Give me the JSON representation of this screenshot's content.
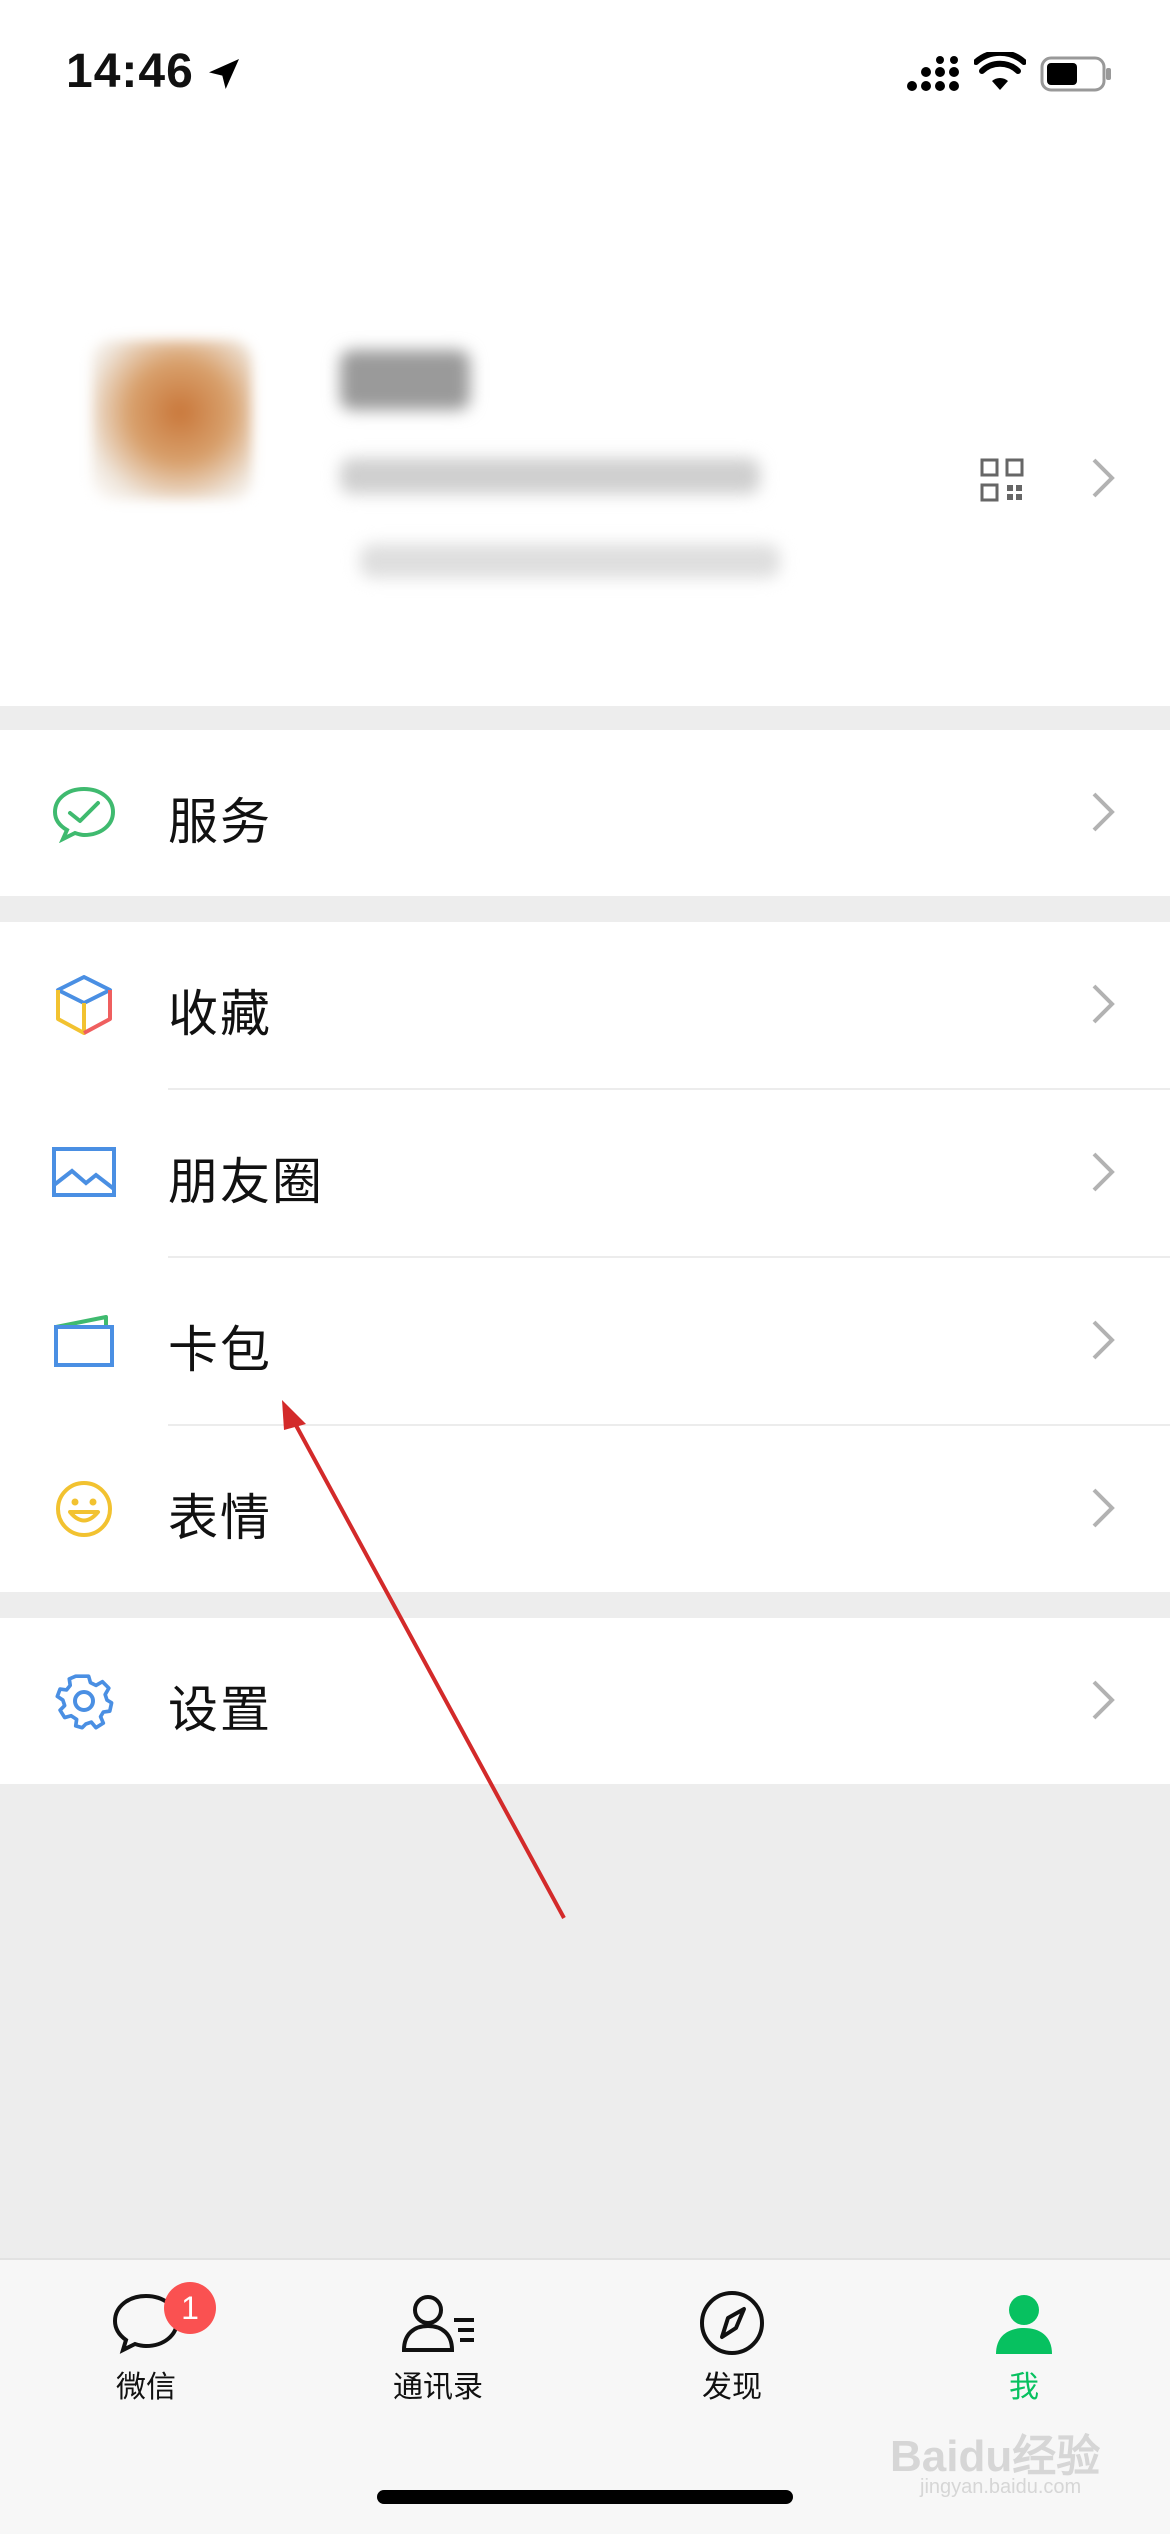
{
  "status_bar": {
    "time": "14:46"
  },
  "menu": {
    "services": {
      "label": "服务"
    },
    "favorites": {
      "label": "收藏"
    },
    "moments": {
      "label": "朋友圈"
    },
    "card_wallet": {
      "label": "卡包"
    },
    "stickers": {
      "label": "表情"
    },
    "settings": {
      "label": "设置"
    }
  },
  "tabbar": {
    "chats": {
      "label": "微信",
      "badge": "1"
    },
    "contacts": {
      "label": "通讯录"
    },
    "discover": {
      "label": "发现"
    },
    "me": {
      "label": "我"
    }
  },
  "watermark": {
    "brand": "Baidu经验",
    "url": "jingyan.baidu.com"
  },
  "colors": {
    "accent": "#07c160",
    "badge": "#fa5151",
    "annotation_arrow": "#d32a2a"
  }
}
